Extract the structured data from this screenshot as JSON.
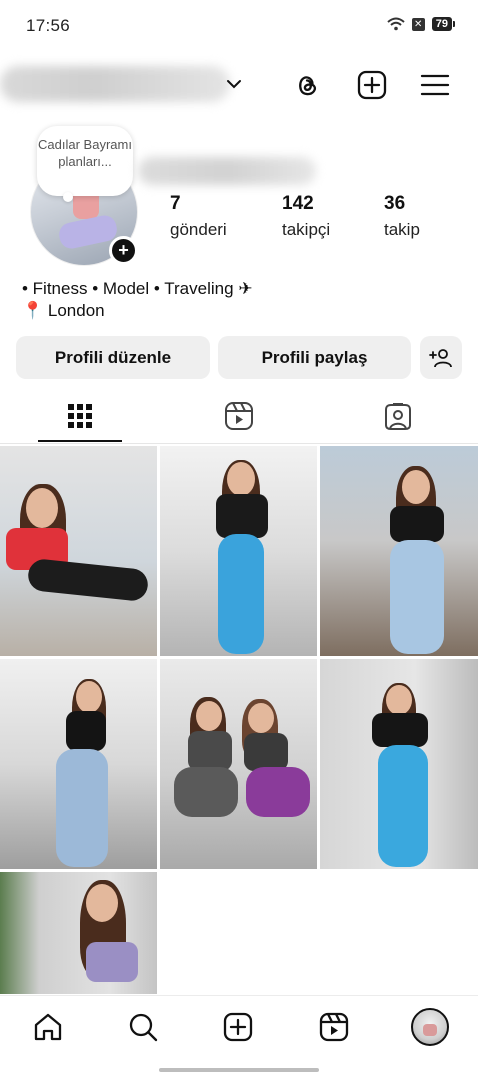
{
  "status_bar": {
    "time": "17:56",
    "battery": "79"
  },
  "profile": {
    "note": "Cadılar Bayramı planları...",
    "stats": [
      {
        "value": "7",
        "label": "gönderi"
      },
      {
        "value": "142",
        "label": "takipçi"
      },
      {
        "value": "36",
        "label": "takip"
      }
    ],
    "bio_line1": "• Fitness • Model • Traveling ✈",
    "bio_line2": "📍 London"
  },
  "actions": {
    "edit_profile": "Profili düzenle",
    "share_profile": "Profili paylaş"
  },
  "tabs": [
    "grid-icon",
    "reels-icon",
    "tagged-icon"
  ],
  "grid": {
    "post_count": 7
  },
  "nav": [
    "home-icon",
    "search-icon",
    "create-icon",
    "reels-icon",
    "profile-avatar"
  ]
}
